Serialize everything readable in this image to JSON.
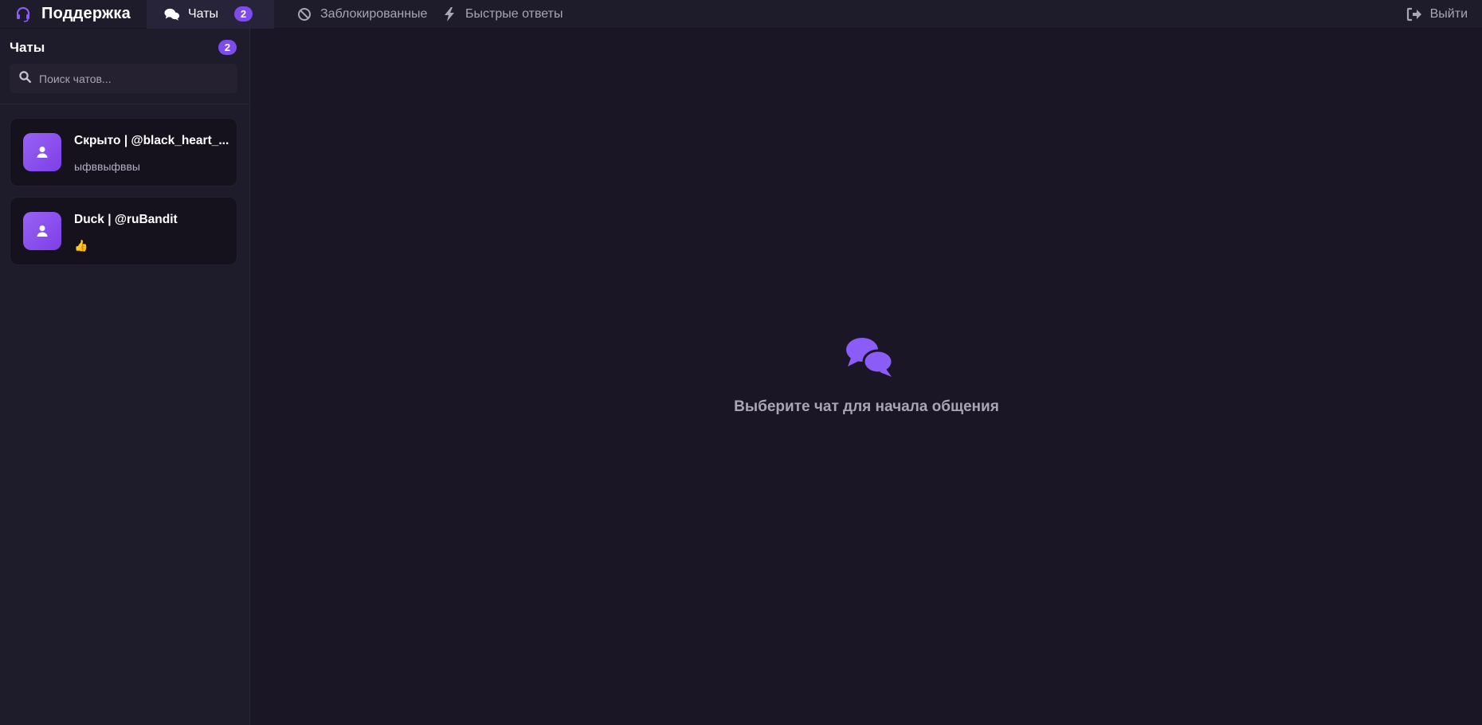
{
  "header": {
    "brand_title": "Поддержка",
    "tabs": [
      {
        "label": "Чаты",
        "badge": "2",
        "icon": "comments-icon",
        "active": true
      },
      {
        "label": "Заблокированные",
        "icon": "ban-icon"
      },
      {
        "label": "Быстрые ответы",
        "icon": "bolt-icon"
      }
    ],
    "logout_label": "Выйти"
  },
  "sidebar": {
    "title": "Чаты",
    "count": "2",
    "search_placeholder": "Поиск чатов...",
    "chats": [
      {
        "name": "Скрыто | @black_heart_...",
        "preview": "ыфввыфввы"
      },
      {
        "name": "Duck | @ruBandit",
        "preview": "👍"
      }
    ]
  },
  "main": {
    "empty_text": "Выберите чат для начала общения"
  },
  "colors": {
    "accent": "#7c4dea",
    "background": "#1a1625",
    "panel": "#1e1b2a"
  }
}
